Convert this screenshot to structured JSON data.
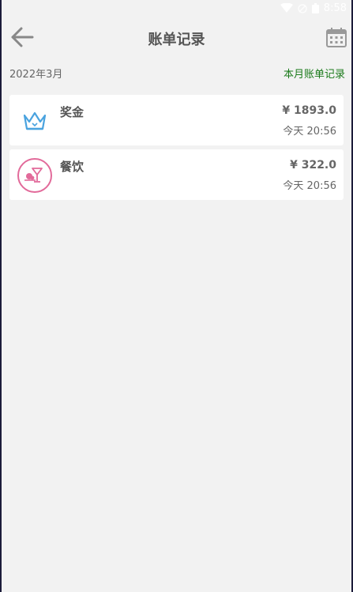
{
  "status_bar": {
    "time": "8:58"
  },
  "header": {
    "title": "账单记录"
  },
  "subheader": {
    "month": "2022年3月",
    "month_link": "本月账单记录"
  },
  "bills": [
    {
      "name": "奖金",
      "amount": "¥ 1893.0",
      "time": "今天 20:56",
      "icon": "crown-icon"
    },
    {
      "name": "餐饮",
      "amount": "¥ 322.0",
      "time": "今天 20:56",
      "icon": "dining-icon"
    }
  ],
  "colors": {
    "background": "#f2f2f2",
    "link_green": "#1a7a1a",
    "crown_blue": "#4aa3df",
    "dining_pink": "#e26a9a"
  }
}
